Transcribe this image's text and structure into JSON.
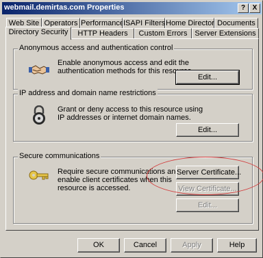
{
  "window": {
    "title": "webmail.demirtas.com Properties",
    "help_btn": "?",
    "close_btn": "X"
  },
  "tabs_row1": [
    "Web Site",
    "Operators",
    "Performance",
    "ISAPI Filters",
    "Home Directory",
    "Documents"
  ],
  "tabs_row2": [
    "Directory Security",
    "HTTP Headers",
    "Custom Errors",
    "Server Extensions"
  ],
  "active_tab": "Directory Security",
  "groups": {
    "anon": {
      "legend": "Anonymous access and authentication control",
      "line1": "Enable anonymous access and edit the",
      "line2": "authentication methods for this resource.",
      "edit": "Edit...",
      "icon": "handshake-icon"
    },
    "ip": {
      "legend": "IP address and domain name restrictions",
      "line1": "Grant or deny access to this resource using",
      "line2": "IP addresses or internet domain names.",
      "edit": "Edit...",
      "icon": "padlock-icon"
    },
    "secure": {
      "legend": "Secure communications",
      "line1": "Require secure communications and",
      "line2": "enable client certificates when this",
      "line3": "resource is accessed.",
      "server_cert": "Server Certificate...",
      "view_cert": "View Certificate...",
      "edit": "Edit...",
      "icon": "key-icon",
      "highlight_color": "#d23a3a"
    }
  },
  "footer": {
    "ok": "OK",
    "cancel": "Cancel",
    "apply": "Apply",
    "help": "Help"
  }
}
